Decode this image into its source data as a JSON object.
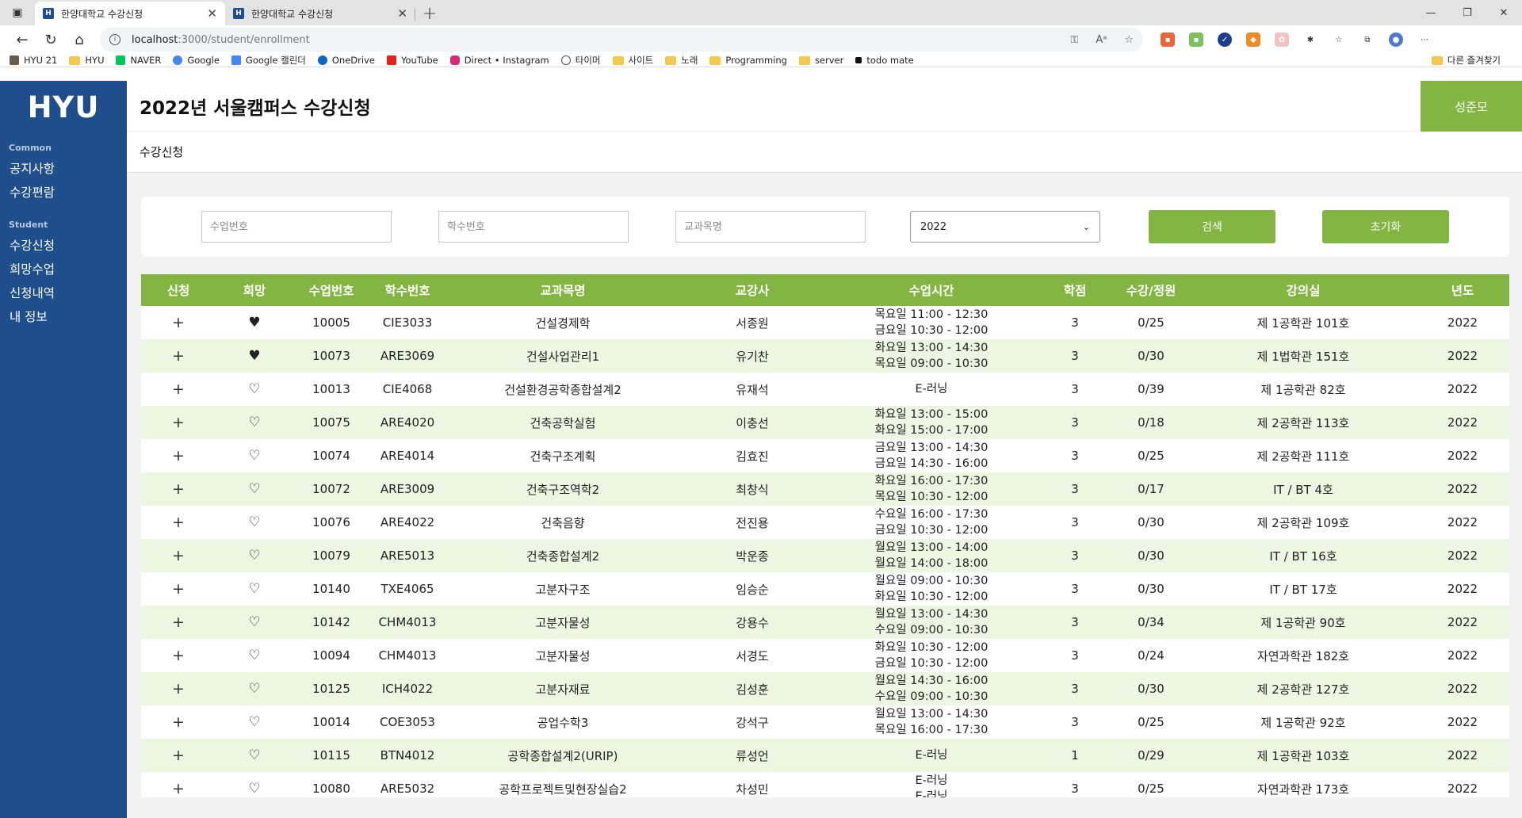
{
  "browser": {
    "tabs": [
      {
        "title": "한양대학교 수강신청",
        "favicon": "H"
      },
      {
        "title": "한양대학교 수강신청",
        "favicon": "H"
      }
    ],
    "url_host": "localhost",
    "url_path": ":3000/student/enrollment",
    "bookmarks": [
      "HYU 21",
      "HYU",
      "NAVER",
      "Google",
      "Google 캘린더",
      "OneDrive",
      "YouTube",
      "Direct • Instagram",
      "타이머",
      "사이트",
      "노래",
      "Programming",
      "server",
      "todo mate"
    ],
    "other_bookmarks": "다른 즐겨찾기"
  },
  "sidebar": {
    "logo": "HYU",
    "sections": [
      {
        "title": "Common",
        "items": [
          "공지사항",
          "수강편람"
        ]
      },
      {
        "title": "Student",
        "items": [
          "수강신청",
          "희망수업",
          "신청내역",
          "내 정보"
        ]
      }
    ]
  },
  "header": {
    "title": "2022년 서울캠퍼스 수강신청",
    "user": "성준모",
    "subtitle": "수강신청"
  },
  "search": {
    "class_no_placeholder": "수업번호",
    "code_placeholder": "학수번호",
    "name_placeholder": "교과목명",
    "year_selected": "2022",
    "search_label": "검색",
    "reset_label": "초기화"
  },
  "table": {
    "headers": [
      "신청",
      "희망",
      "수업번호",
      "학수번호",
      "교과목명",
      "교강사",
      "수업시간",
      "학점",
      "수강/정원",
      "강의실",
      "년도"
    ],
    "rows": [
      {
        "wish": true,
        "num": "10005",
        "code": "CIE3033",
        "name": "건설경제학",
        "prof": "서종원",
        "time1": "목요일 11:00 - 12:30",
        "time2": "금요일 10:30 - 12:00",
        "credit": "3",
        "count": "0/25",
        "room": "제 1공학관 101호",
        "year": "2022"
      },
      {
        "wish": true,
        "num": "10073",
        "code": "ARE3069",
        "name": "건설사업관리1",
        "prof": "유기찬",
        "time1": "화요일 13:00 - 14:30",
        "time2": "목요일 09:00 - 10:30",
        "credit": "3",
        "count": "0/30",
        "room": "제 1법학관 151호",
        "year": "2022"
      },
      {
        "wish": false,
        "num": "10013",
        "code": "CIE4068",
        "name": "건설환경공학종합설계2",
        "prof": "유재석",
        "time1": "E-러닝",
        "time2": "",
        "credit": "3",
        "count": "0/39",
        "room": "제 1공학관 82호",
        "year": "2022"
      },
      {
        "wish": false,
        "num": "10075",
        "code": "ARE4020",
        "name": "건축공학실험",
        "prof": "이충선",
        "time1": "화요일 13:00 - 15:00",
        "time2": "화요일 15:00 - 17:00",
        "credit": "3",
        "count": "0/18",
        "room": "제 2공학관 113호",
        "year": "2022"
      },
      {
        "wish": false,
        "num": "10074",
        "code": "ARE4014",
        "name": "건축구조계획",
        "prof": "김효진",
        "time1": "금요일 13:00 - 14:30",
        "time2": "금요일 14:30 - 16:00",
        "credit": "3",
        "count": "0/25",
        "room": "제 2공학관 111호",
        "year": "2022"
      },
      {
        "wish": false,
        "num": "10072",
        "code": "ARE3009",
        "name": "건축구조역학2",
        "prof": "최창식",
        "time1": "화요일 16:00 - 17:30",
        "time2": "목요일 10:30 - 12:00",
        "credit": "3",
        "count": "0/17",
        "room": "IT / BT 4호",
        "year": "2022"
      },
      {
        "wish": false,
        "num": "10076",
        "code": "ARE4022",
        "name": "건축음향",
        "prof": "전진용",
        "time1": "수요일 16:00 - 17:30",
        "time2": "금요일 10:30 - 12:00",
        "credit": "3",
        "count": "0/30",
        "room": "제 2공학관 109호",
        "year": "2022"
      },
      {
        "wish": false,
        "num": "10079",
        "code": "ARE5013",
        "name": "건축종합설계2",
        "prof": "박운종",
        "time1": "월요일 13:00 - 14:00",
        "time2": "월요일 14:00 - 18:00",
        "credit": "3",
        "count": "0/30",
        "room": "IT / BT 16호",
        "year": "2022"
      },
      {
        "wish": false,
        "num": "10140",
        "code": "TXE4065",
        "name": "고분자구조",
        "prof": "임승순",
        "time1": "월요일 09:00 - 10:30",
        "time2": "화요일 10:30 - 12:00",
        "credit": "3",
        "count": "0/30",
        "room": "IT / BT 17호",
        "year": "2022"
      },
      {
        "wish": false,
        "num": "10142",
        "code": "CHM4013",
        "name": "고분자물성",
        "prof": "강용수",
        "time1": "월요일 13:00 - 14:30",
        "time2": "수요일 09:00 - 10:30",
        "credit": "3",
        "count": "0/34",
        "room": "제 1공학관 90호",
        "year": "2022"
      },
      {
        "wish": false,
        "num": "10094",
        "code": "CHM4013",
        "name": "고분자물성",
        "prof": "서경도",
        "time1": "화요일 10:30 - 12:00",
        "time2": "금요일 10:30 - 12:00",
        "credit": "3",
        "count": "0/24",
        "room": "자연과학관 182호",
        "year": "2022"
      },
      {
        "wish": false,
        "num": "10125",
        "code": "ICH4022",
        "name": "고분자재료",
        "prof": "김성훈",
        "time1": "월요일 14:30 - 16:00",
        "time2": "수요일 09:00 - 10:30",
        "credit": "3",
        "count": "0/30",
        "room": "제 2공학관 127호",
        "year": "2022"
      },
      {
        "wish": false,
        "num": "10014",
        "code": "COE3053",
        "name": "공업수학3",
        "prof": "강석구",
        "time1": "월요일 13:00 - 14:30",
        "time2": "목요일 16:00 - 17:30",
        "credit": "3",
        "count": "0/25",
        "room": "제 1공학관 92호",
        "year": "2022"
      },
      {
        "wish": false,
        "num": "10115",
        "code": "BTN4012",
        "name": "공학종합설계2(URIP)",
        "prof": "류성언",
        "time1": "E-러닝",
        "time2": "",
        "credit": "1",
        "count": "0/29",
        "room": "제 1공학관 103호",
        "year": "2022"
      },
      {
        "wish": false,
        "num": "10080",
        "code": "ARE5032",
        "name": "공학프로젝트및현장실습2",
        "prof": "차성민",
        "time1": "E-러닝",
        "time2": "E-러닝",
        "credit": "3",
        "count": "0/25",
        "room": "자연과학관 173호",
        "year": "2022"
      }
    ]
  }
}
